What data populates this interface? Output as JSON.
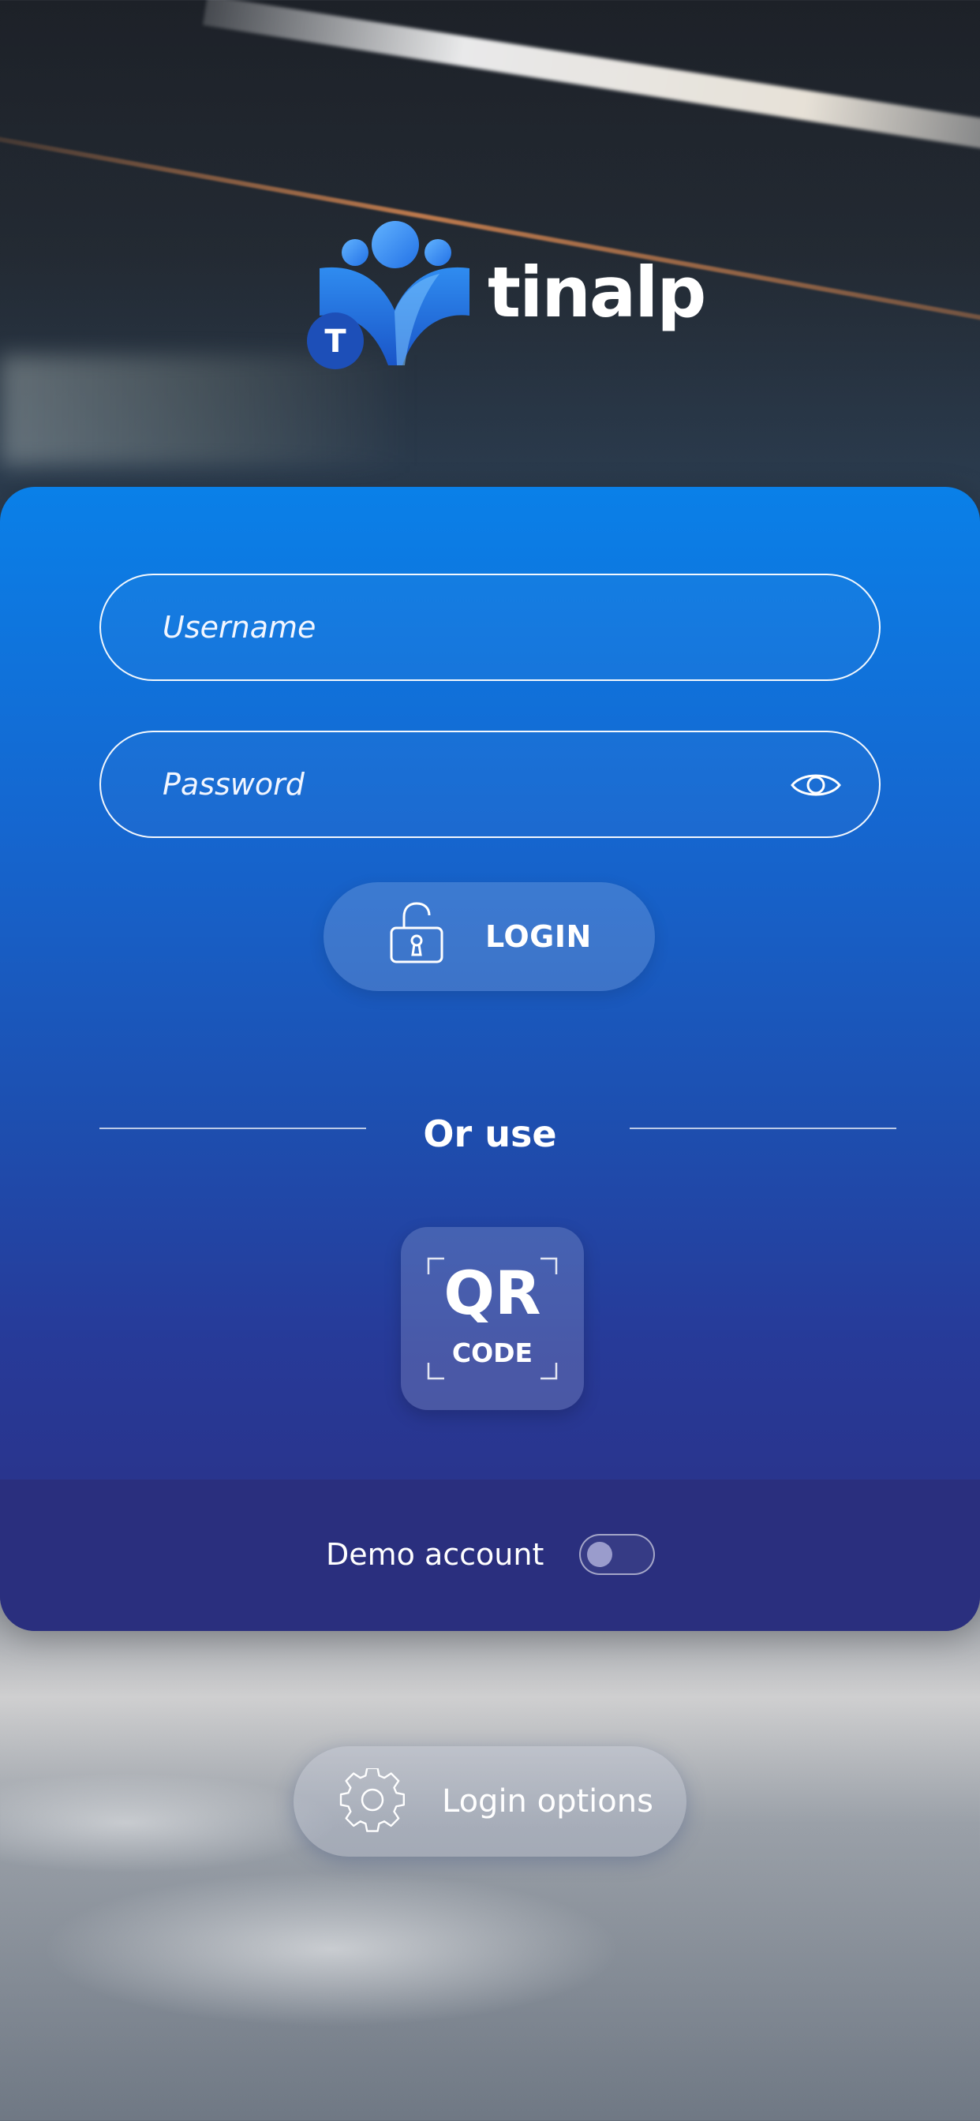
{
  "brand": {
    "name": "tinalp",
    "badge_letter": "T"
  },
  "login_form": {
    "username_placeholder": "Username",
    "password_placeholder": "Password",
    "login_label": "LOGIN"
  },
  "alternative": {
    "divider_text": "Or use",
    "qr_label_main": "QR",
    "qr_label_sub": "CODE"
  },
  "demo": {
    "label": "Demo account",
    "enabled": false
  },
  "footer": {
    "options_label": "Login options"
  },
  "colors": {
    "card_top": "#0a80e8",
    "card_bottom": "#2c2f82",
    "demo_bar": "#2a2f7e",
    "logo_blue": "#1f6fe0"
  }
}
